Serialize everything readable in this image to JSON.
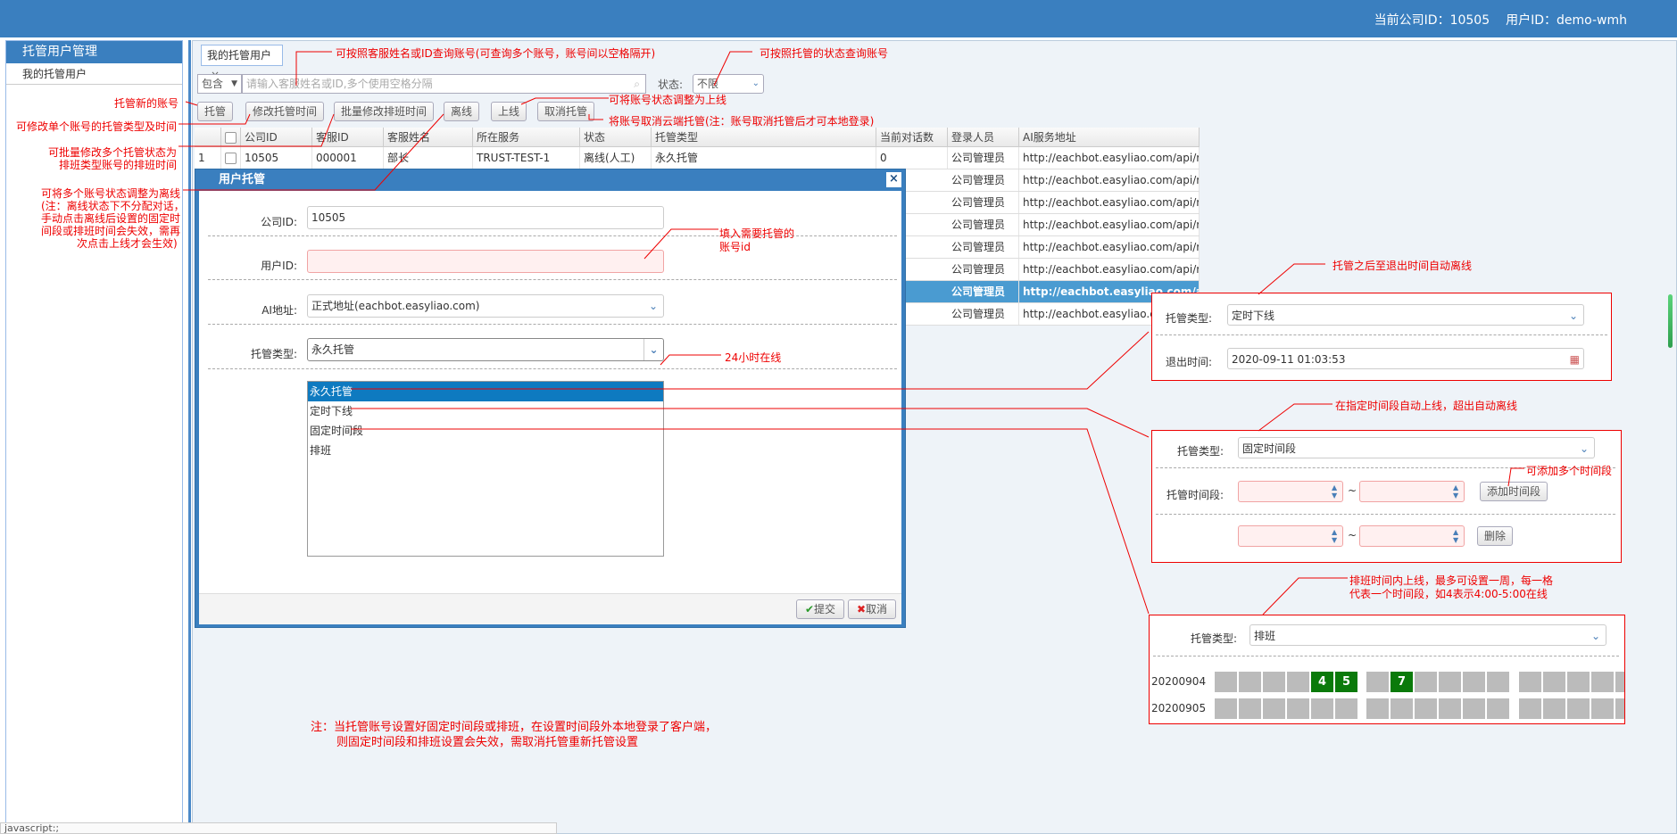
{
  "topbar": {
    "company_label": "当前公司ID：10505",
    "user_label": "用户ID：demo-wmh"
  },
  "sidebar": {
    "header": "托管用户管理",
    "items": [
      {
        "label": "我的托管用户"
      }
    ]
  },
  "tab": {
    "label": "我的托管用户",
    "close": "×"
  },
  "filter": {
    "match_mode": "包含",
    "search_placeholder": "请输入客服姓名或ID,多个使用空格分隔",
    "status_label": "状态:",
    "status_value": "不限"
  },
  "toolbar": {
    "trust": "托管",
    "modify_time": "修改托管时间",
    "batch_modify": "批量修改排班时间",
    "offline": "离线",
    "online": "上线",
    "cancel_trust": "取消托管"
  },
  "table": {
    "headers": [
      "公司ID",
      "客服ID",
      "客服姓名",
      "所在服务",
      "状态",
      "托管类型",
      "当前对话数",
      "登录人员",
      "AI服务地址"
    ],
    "first_row": {
      "index": "1",
      "company": "10505",
      "cs_id": "000001",
      "name": "部长",
      "service": "TRUST-TEST-1",
      "status": "离线(人工)",
      "type": "永久托管",
      "count": "0",
      "login": "公司管理员",
      "url": "http://eachbot.easyliao.com/api/r"
    },
    "login_values": [
      "公司管理员",
      "公司管理员",
      "公司管理员",
      "公司管理员",
      "公司管理员",
      "公司管理员",
      "公司管理员"
    ],
    "url_values": [
      "http://eachbot.easyliao.com/api/r",
      "http://eachbot.easyliao.com/api/r",
      "http://eachbot.easyliao.com/api/r",
      "http://eachbot.easyliao.com/api/r",
      "http://eachbot.easyliao.com/api/r",
      "http://eachbot.easyliao.com/api/r",
      "http://eachbot.easyliao.com/api/r"
    ],
    "selected_row_index": 5
  },
  "dialog": {
    "title": "用户托管",
    "close": "×",
    "company_label": "公司ID:",
    "company_value": "10505",
    "user_label": "用户ID:",
    "user_value": "",
    "ai_label": "AI地址:",
    "ai_value": "正式地址(eachbot.easyliao.com)",
    "type_label": "托管类型:",
    "type_value": "永久托管",
    "options": [
      "永久托管",
      "定时下线",
      "固定时间段",
      "排班"
    ],
    "submit": "提交",
    "cancel": "取消"
  },
  "panel_timed": {
    "type_label": "托管类型:",
    "type_value": "定时下线",
    "exit_label": "退出时间:",
    "exit_value": "2020-09-11 01:03:53"
  },
  "panel_fixed": {
    "type_label": "托管类型:",
    "type_value": "固定时间段",
    "period_label": "托管时间段:",
    "tilde": "~",
    "add_button": "添加时间段",
    "delete_button": "删除"
  },
  "panel_schedule": {
    "type_label": "托管类型:",
    "type_value": "排班",
    "day1": "20200904",
    "day2": "20200905",
    "on_cells": [
      "4",
      "5",
      "7"
    ]
  },
  "annotations": {
    "search": "可按照客服姓名或ID查询账号(可查询多个账号，账号间以空格隔开)",
    "status": "可按照托管的状态查询账号",
    "online": "可将账号状态调整为上线",
    "cancel": "将账号取消云端托管(注：账号取消托管后才可本地登录)",
    "trust": "托管新的账号",
    "modify": "可修改单个账号的托管类型及时间",
    "batch1": "可批量修改多个托管状态为",
    "batch2": "排班类型账号的排班时间",
    "offline1": "可将多个账号状态调整为离线",
    "offline2": "(注：离线状态下不分配对话，",
    "offline3": "手动点击离线后设置的固定时",
    "offline4": "间段或排班时间会失效，需再",
    "offline5": "次点击上线才会生效)",
    "userid1": "填入需要托管的",
    "userid2": "账号id",
    "online24": "24小时在线",
    "timed": "托管之后至退出时间自动离线",
    "fixed": "在指定时间段自动上线，超出自动离线",
    "addmore": "可添加多个时间段",
    "sched1": "排班时间内上线，最多可设置一周，每一格",
    "sched2": "代表一个时间段，如4表示4:00-5:00在线",
    "note1": "注：当托管账号设置好固定时间段或排班，在设置时间段外本地登录了客户端，",
    "note2": "则固定时间段和排班设置会失效，需取消托管重新托管设置"
  },
  "statusbar": {
    "text": "javascript:;"
  }
}
